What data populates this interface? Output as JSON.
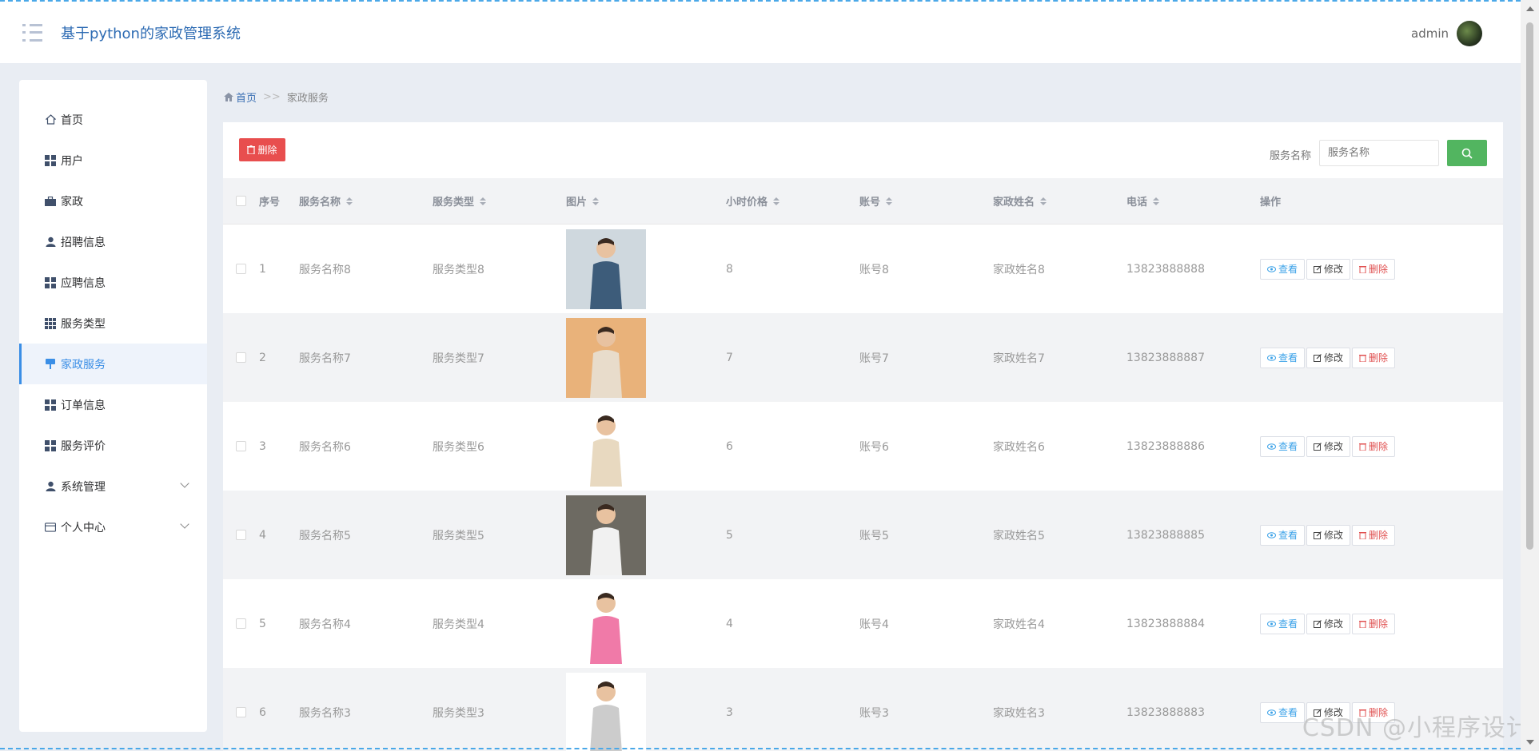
{
  "header": {
    "title": "基于python的家政管理系统",
    "username": "admin"
  },
  "sidebar": {
    "items": [
      {
        "label": "首页",
        "icon": "home-icon"
      },
      {
        "label": "用户",
        "icon": "grid-icon"
      },
      {
        "label": "家政",
        "icon": "briefcase-icon"
      },
      {
        "label": "招聘信息",
        "icon": "user-icon"
      },
      {
        "label": "应聘信息",
        "icon": "grid-icon"
      },
      {
        "label": "服务类型",
        "icon": "grid9-icon"
      },
      {
        "label": "家政服务",
        "icon": "pin-icon",
        "active": true
      },
      {
        "label": "订单信息",
        "icon": "grid-icon"
      },
      {
        "label": "服务评价",
        "icon": "grid-icon"
      },
      {
        "label": "系统管理",
        "icon": "user-icon",
        "expandable": true
      },
      {
        "label": "个人中心",
        "icon": "card-icon",
        "expandable": true
      }
    ]
  },
  "breadcrumb": {
    "home": "首页",
    "separator": ">>",
    "current": "家政服务"
  },
  "toolbar": {
    "delete_label": "删除",
    "search_label": "服务名称",
    "search_placeholder": "服务名称"
  },
  "table": {
    "headers": {
      "index": "序号",
      "name": "服务名称",
      "type": "服务类型",
      "image": "图片",
      "price": "小时价格",
      "account": "账号",
      "hname": "家政姓名",
      "phone": "电话",
      "ops": "操作"
    },
    "op_labels": {
      "view": "查看",
      "edit": "修改",
      "delete": "删除"
    },
    "rows": [
      {
        "index": "1",
        "name": "服务名称8",
        "type": "服务类型8",
        "price": "8",
        "account": "账号8",
        "hname": "家政姓名8",
        "phone": "13823888888",
        "img_bg": "#cfd8de",
        "img_fg": "#3d5c7a"
      },
      {
        "index": "2",
        "name": "服务名称7",
        "type": "服务类型7",
        "price": "7",
        "account": "账号7",
        "hname": "家政姓名7",
        "phone": "13823888887",
        "img_bg": "#e9b27a",
        "img_fg": "#e8dccb"
      },
      {
        "index": "3",
        "name": "服务名称6",
        "type": "服务类型6",
        "price": "6",
        "account": "账号6",
        "hname": "家政姓名6",
        "phone": "13823888886",
        "img_bg": "#ffffff",
        "img_fg": "#e8d9c0"
      },
      {
        "index": "4",
        "name": "服务名称5",
        "type": "服务类型5",
        "price": "5",
        "account": "账号5",
        "hname": "家政姓名5",
        "phone": "13823888885",
        "img_bg": "#6d6a62",
        "img_fg": "#f1f1f1"
      },
      {
        "index": "5",
        "name": "服务名称4",
        "type": "服务类型4",
        "price": "4",
        "account": "账号4",
        "hname": "家政姓名4",
        "phone": "13823888884",
        "img_bg": "#ffffff",
        "img_fg": "#f07aa8"
      },
      {
        "index": "6",
        "name": "服务名称3",
        "type": "服务类型3",
        "price": "3",
        "account": "账号3",
        "hname": "家政姓名3",
        "phone": "13823888883",
        "img_bg": "#ffffff",
        "img_fg": "#cccccc"
      }
    ]
  },
  "watermark": "CSDN @小程序设计"
}
